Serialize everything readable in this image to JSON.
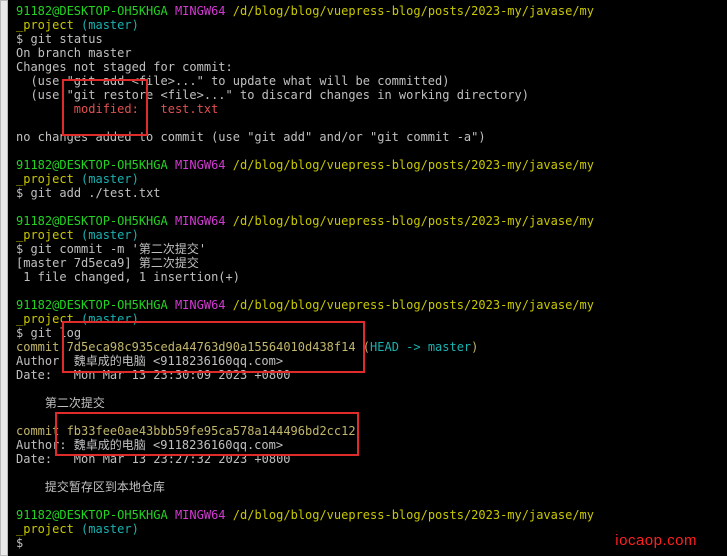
{
  "terminal": {
    "user_host": "91182@DESKTOP-OH5KHGA",
    "shell": "MINGW64",
    "path_part1": "/d/blog/blog/vuepress-blog/posts/2023-my/javase/my",
    "path_part2": "_project",
    "branch": "(master)",
    "prompt": "$"
  },
  "block1": {
    "cmd": "git status",
    "line1": "On branch master",
    "line2": "Changes not staged for commit:",
    "line3": "  (use \"git add <file>...\" to update what will be committed)",
    "line4": "  (use \"git restore <file>...\" to discard changes in working directory)",
    "modified_label": "        modified:",
    "modified_file": "   test.txt",
    "line6": "no changes added to commit (use \"git add\" and/or \"git commit -a\")"
  },
  "block2": {
    "cmd": "git add ./test.txt"
  },
  "block3": {
    "cmd": "git commit -m '第二次提交'",
    "line1": "[master 7d5eca9] 第二次提交",
    "line2": " 1 file changed, 1 insertion(+)"
  },
  "block4": {
    "cmd": "git log",
    "commit1_label": "commit ",
    "commit1_hash": "7d5eca98c935ceda44763d90a15564010d438f14",
    "commit1_ref_open": " (",
    "commit1_head": "HEAD -> master",
    "commit1_ref_close": ")",
    "commit1_author": "Author: 魏卓成的电脑 <9118236160qq.com>",
    "commit1_date": "Date:   Mon Mar 13 23:30:09 2023 +0800",
    "commit1_msg": "    第二次提交",
    "commit2_label": "commit ",
    "commit2_hash": "fb33fee0ae43bbb59fe95ca578a144496bd2cc12",
    "commit2_author": "Author: 魏卓成的电脑 <9118236160qq.com>",
    "commit2_date": "Date:   Mon Mar 13 23:27:32 2023 +0800",
    "commit2_msg": "    提交暂存区到本地仓库"
  },
  "cursor": "$",
  "watermark": "iocaop.com"
}
